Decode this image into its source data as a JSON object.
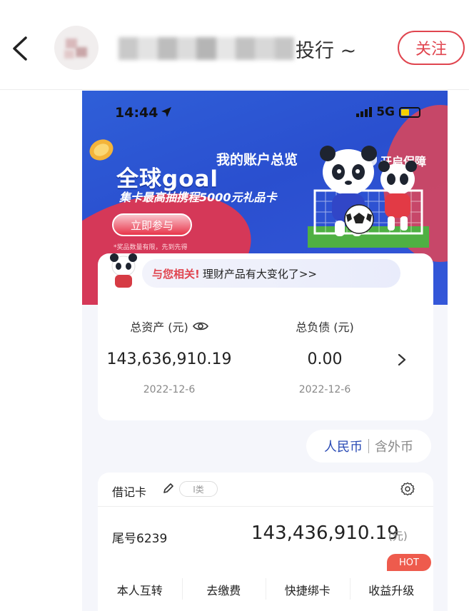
{
  "header": {
    "account_name_visible_suffix": "投行 ~",
    "follow_label": "关注"
  },
  "status_bar": {
    "time": "14:44",
    "network": "5G"
  },
  "banner": {
    "promo_title": "全球goal",
    "promo_subtitle": "集卡最高抽携程5000元礼品卡",
    "overview_title": "我的账户总览",
    "protect_label": "开启保障",
    "join_label": "立即参与",
    "fine_print": "*奖品数量有限，先到先得"
  },
  "notice": {
    "highlight": "与您相关!",
    "message": "理财产品有大变化了>>"
  },
  "assets": {
    "total_assets_label": "总资产 (元)",
    "total_assets_value": "143,636,910.19",
    "total_assets_date": "2022-12-6",
    "total_liabilities_label": "总负债 (元)",
    "total_liabilities_value": "0.00",
    "total_liabilities_date": "2022-12-6"
  },
  "currency": {
    "selected": "人民币",
    "other": "含外币"
  },
  "debit_card": {
    "title": "借记卡",
    "tier_tag": "I类",
    "tail_label": "尾号6239",
    "balance": "143,436,910.19",
    "unit": "(元)",
    "actions": [
      {
        "label": "本人互转"
      },
      {
        "label": "去缴费"
      },
      {
        "label": "快捷绑卡"
      },
      {
        "label": "收益升级"
      }
    ],
    "hot_badge": "HOT"
  },
  "colors": {
    "accent_red": "#e0454f",
    "banner_blue": "#2f5fd8",
    "currency_blue": "#2a4bb5"
  }
}
